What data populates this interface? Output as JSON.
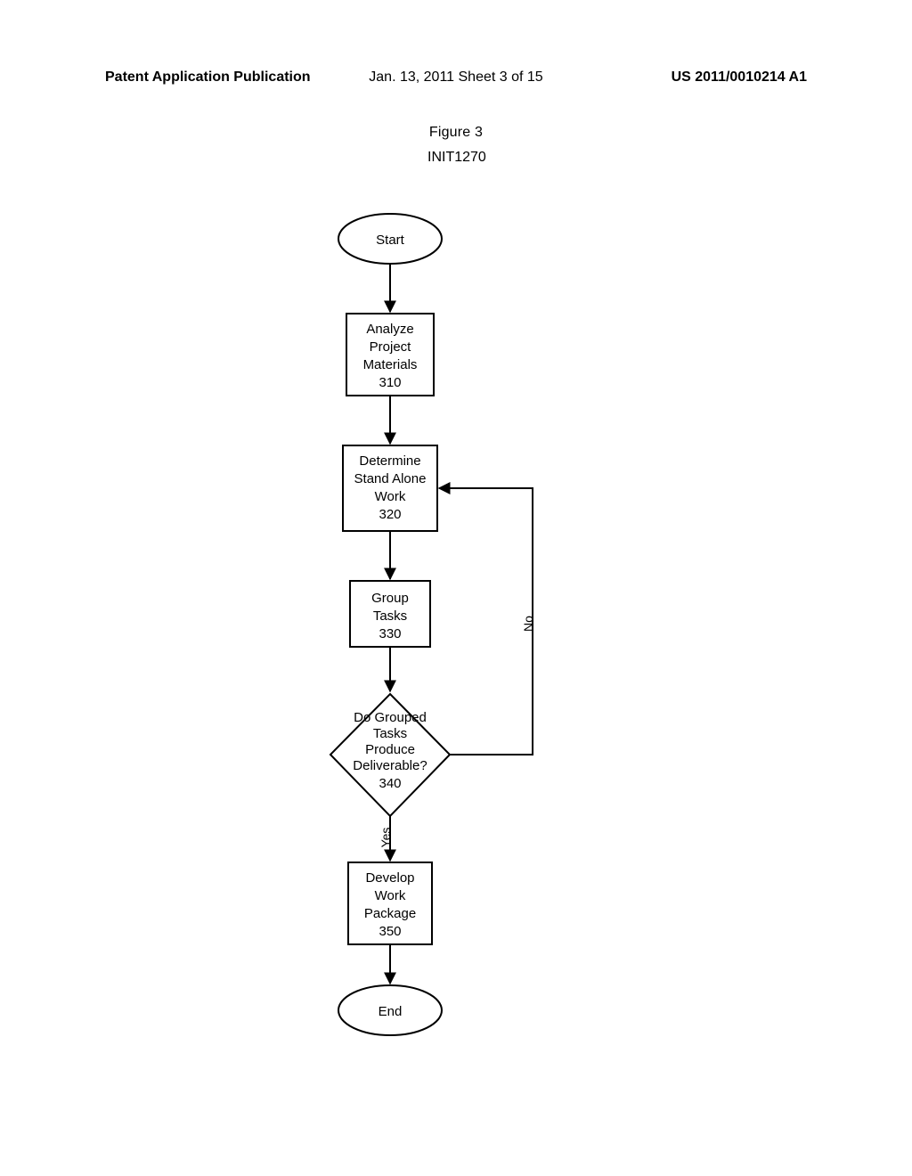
{
  "header": {
    "left": "Patent Application Publication",
    "center": "Jan. 13, 2011  Sheet 3 of 15",
    "right": "US 2011/0010214 A1"
  },
  "figure": {
    "title": "Figure 3",
    "init": "INIT1270"
  },
  "flow": {
    "start": "Start",
    "end": "End",
    "step310_l1": "Analyze",
    "step310_l2": "Project",
    "step310_l3": "Materials",
    "step310_l4": "310",
    "step320_l1": "Determine",
    "step320_l2": "Stand Alone",
    "step320_l3": "Work",
    "step320_l4": "320",
    "step330_l1": "Group",
    "step330_l2": "Tasks",
    "step330_l3": "330",
    "dec340_l1": "Do Grouped",
    "dec340_l2": "Tasks",
    "dec340_l3": "Produce",
    "dec340_l4": "Deliverable?",
    "dec340_l5": "340",
    "step350_l1": "Develop",
    "step350_l2": "Work",
    "step350_l3": "Package",
    "step350_l4": "350",
    "yes": "Yes",
    "no": "No"
  },
  "chart_data": {
    "type": "flowchart",
    "title": "Figure 3",
    "reference": "INIT1270",
    "nodes": [
      {
        "id": "start",
        "type": "terminator",
        "label": "Start"
      },
      {
        "id": "310",
        "type": "process",
        "label": "Analyze Project Materials 310"
      },
      {
        "id": "320",
        "type": "process",
        "label": "Determine Stand Alone Work 320"
      },
      {
        "id": "330",
        "type": "process",
        "label": "Group Tasks 330"
      },
      {
        "id": "340",
        "type": "decision",
        "label": "Do Grouped Tasks Produce Deliverable? 340"
      },
      {
        "id": "350",
        "type": "process",
        "label": "Develop Work Package 350"
      },
      {
        "id": "end",
        "type": "terminator",
        "label": "End"
      }
    ],
    "edges": [
      {
        "from": "start",
        "to": "310"
      },
      {
        "from": "310",
        "to": "320"
      },
      {
        "from": "320",
        "to": "330"
      },
      {
        "from": "330",
        "to": "340"
      },
      {
        "from": "340",
        "to": "350",
        "label": "Yes"
      },
      {
        "from": "340",
        "to": "320",
        "label": "No"
      },
      {
        "from": "350",
        "to": "end"
      }
    ]
  }
}
